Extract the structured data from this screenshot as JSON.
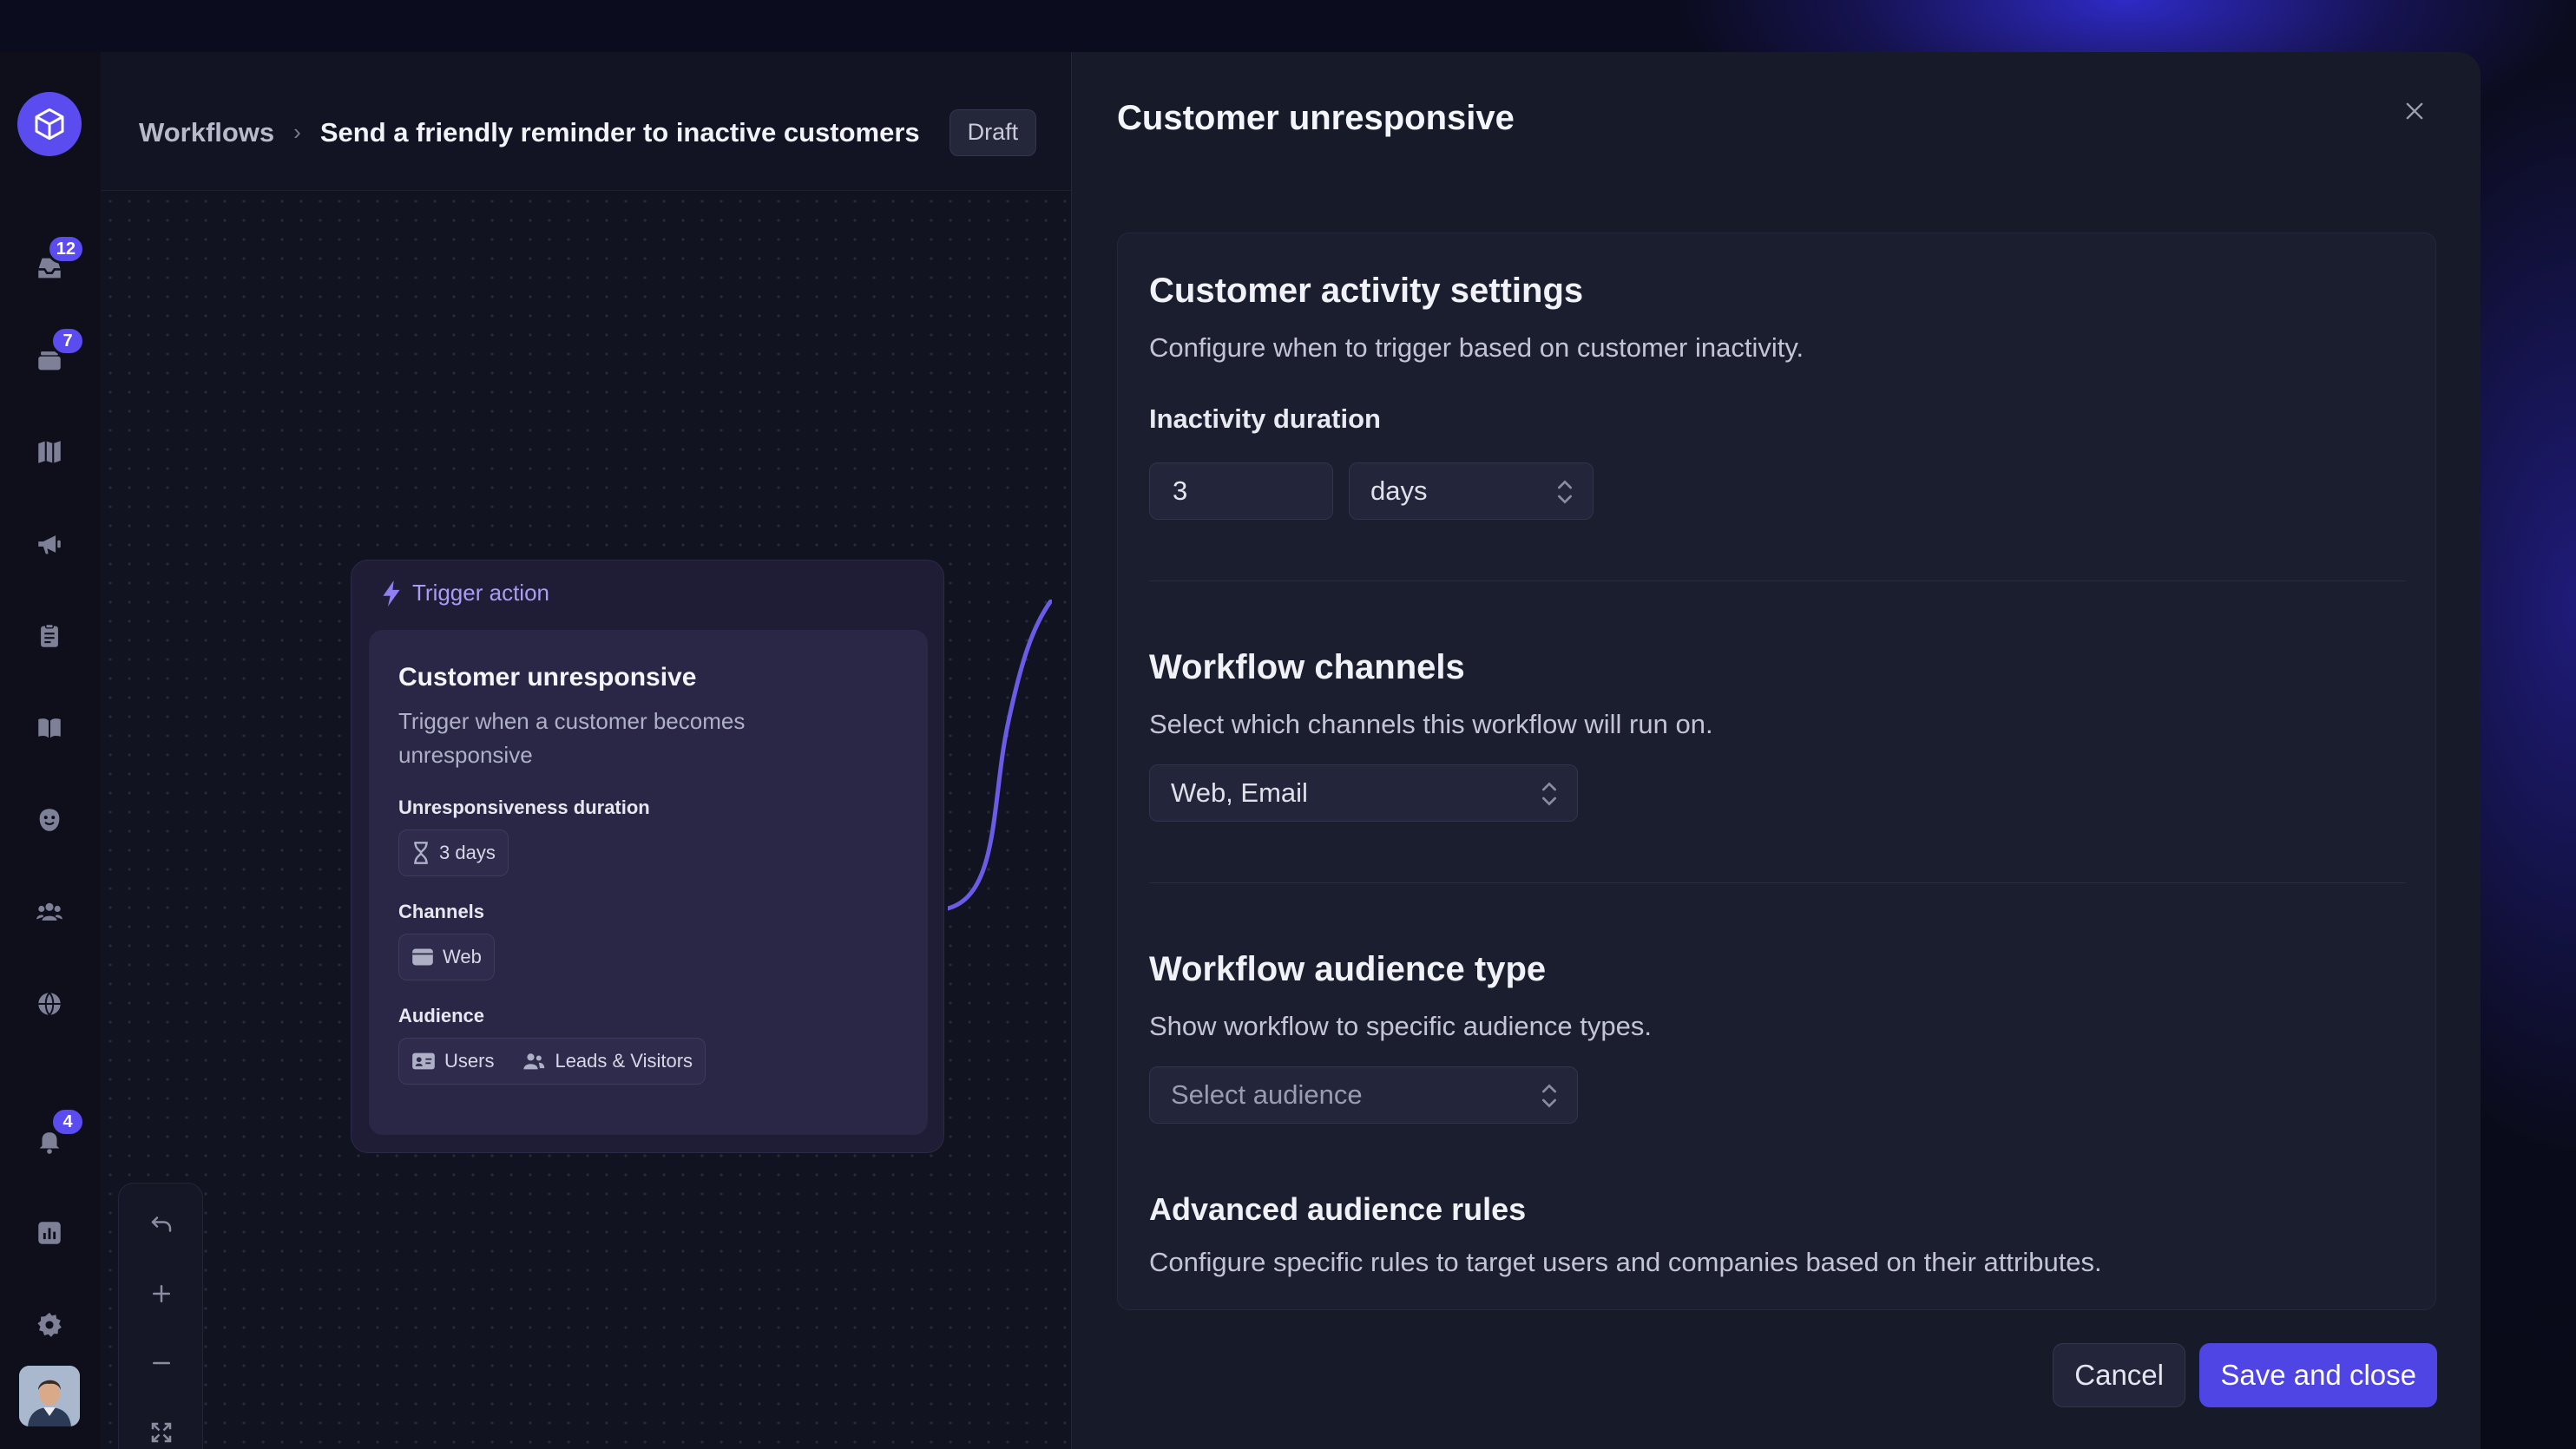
{
  "breadcrumb": {
    "root": "Workflows",
    "separator": "›",
    "title": "Send a friendly reminder to inactive customers",
    "status": "Draft"
  },
  "rail": {
    "items": [
      {
        "icon": "inbox-icon",
        "badge": "12"
      },
      {
        "icon": "tickets-icon",
        "badge": "7"
      },
      {
        "icon": "map-icon"
      },
      {
        "icon": "megaphone-icon"
      },
      {
        "icon": "clipboard-icon"
      },
      {
        "icon": "book-icon"
      },
      {
        "icon": "bot-icon"
      },
      {
        "icon": "users-icon"
      },
      {
        "icon": "globe-icon"
      },
      {
        "icon": "bell-icon",
        "badge": "4"
      },
      {
        "icon": "reports-icon"
      },
      {
        "icon": "gear-icon"
      }
    ]
  },
  "node": {
    "header": "Trigger action",
    "title": "Customer unresponsive",
    "description": "Trigger when a customer becomes unresponsive",
    "duration_label": "Unresponsiveness duration",
    "duration_value": "3 days",
    "channels_label": "Channels",
    "channel_value": "Web",
    "audience_label": "Audience",
    "audience_values": [
      "Users",
      "Leads & Visitors"
    ]
  },
  "panel": {
    "title": "Customer unresponsive",
    "activity": {
      "heading": "Customer activity settings",
      "description": "Configure when to trigger based on customer inactivity.",
      "duration_label": "Inactivity duration",
      "duration_value": "3",
      "unit_value": "days"
    },
    "channels": {
      "heading": "Workflow channels",
      "description": "Select which channels this workflow will run on.",
      "value": "Web, Email"
    },
    "audience": {
      "heading": "Workflow audience type",
      "description": "Show workflow to specific audience types.",
      "placeholder": "Select audience"
    },
    "advanced": {
      "heading": "Advanced audience rules",
      "description": "Configure specific rules to target users and companies based on their attributes."
    },
    "cancel_label": "Cancel",
    "save_label": "Save and close"
  },
  "colors": {
    "accent": "#5b4cf0",
    "save_button": "#4f45e4",
    "panel_bg": "#171a29"
  }
}
